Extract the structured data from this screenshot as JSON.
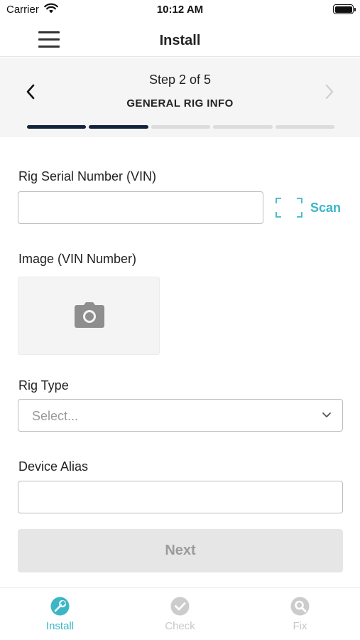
{
  "status_bar": {
    "carrier": "Carrier",
    "time": "10:12 AM"
  },
  "header": {
    "title": "Install"
  },
  "stepper": {
    "step_text": "Step 2 of 5",
    "step_name": "GENERAL RIG INFO",
    "current_step": 2,
    "total_steps": 5
  },
  "form": {
    "vin": {
      "label": "Rig Serial Number (VIN)",
      "value": "",
      "scan_label": "Scan"
    },
    "image": {
      "label": "Image (VIN Number)"
    },
    "rig_type": {
      "label": "Rig Type",
      "selected": "Select..."
    },
    "alias": {
      "label": "Device Alias",
      "value": ""
    },
    "next_label": "Next"
  },
  "tabs": [
    {
      "label": "Install",
      "active": true
    },
    {
      "label": "Check",
      "active": false
    },
    {
      "label": "Fix",
      "active": false
    }
  ],
  "colors": {
    "accent": "#3bb6c7",
    "progress_done": "#15233a",
    "progress_todo": "#dcdcdc",
    "disabled_button": "#e6e6e6",
    "inactive_tab": "#c8c8c8"
  }
}
